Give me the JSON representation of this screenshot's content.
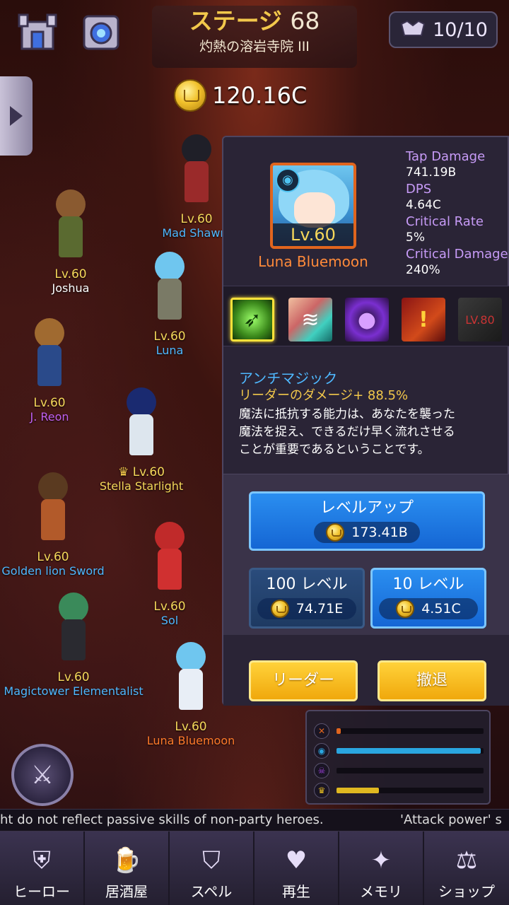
{
  "header": {
    "stage_label": "ステージ",
    "stage_number": "68",
    "stage_subtitle": "灼熱の溶岩寺院 III",
    "energy": "10/10",
    "gold": "120.16C"
  },
  "heroes_field": [
    {
      "level": "Lv.60",
      "name": "Mad Shawn."
    },
    {
      "level": "Lv.60",
      "name": "Joshua"
    },
    {
      "level": "Lv.60",
      "name": "Luna"
    },
    {
      "level": "Lv.60",
      "name": "J. Reon"
    },
    {
      "level": "Lv.60",
      "name": "Stella Starlight"
    },
    {
      "level": "Lv.60",
      "name": "Golden lion Sword"
    },
    {
      "level": "Lv.60",
      "name": "Sol"
    },
    {
      "level": "Lv.60",
      "name": "Magictower Elementalist"
    },
    {
      "level": "Lv.60",
      "name": "Luna Bluemoon"
    }
  ],
  "detail": {
    "portrait_level": "Lv.60",
    "hero_name": "Luna Bluemoon",
    "stats": [
      {
        "label": "Tap Damage",
        "value": "741.19B"
      },
      {
        "label": "DPS",
        "value": "4.64C"
      },
      {
        "label": "Critical Rate",
        "value": "5%"
      },
      {
        "label": "Critical Damage",
        "value": "240%"
      }
    ],
    "locked_skill_label": "LV.80",
    "skill": {
      "name": "アンチマジック",
      "effect": "リーダーのダメージ+ 88.5%",
      "description_lines": [
        "魔法に抵抗する能力は、あなたを襲った",
        "魔法を捉え、できるだけ早く流れさせる",
        "ことが重要であるということです。"
      ]
    },
    "level_up": {
      "label": "レベルアップ",
      "cost": "173.41B"
    },
    "level_100": {
      "label": "100 レベル",
      "cost": "74.71E"
    },
    "level_10": {
      "label": "10 レベル",
      "cost": "4.51C"
    },
    "leader_button": "リーダー",
    "retreat_button": "撤退"
  },
  "mini_panel": {
    "bars": [
      {
        "icon": "sword-icon",
        "fill": 0.03,
        "color": "#e0651e"
      },
      {
        "icon": "water-icon",
        "fill": 0.98,
        "color": "#2aa6e0"
      },
      {
        "icon": "skull-icon",
        "fill": 0.0,
        "color": "#a040e0"
      },
      {
        "icon": "crown-icon",
        "fill": 0.29,
        "color": "#e0b820"
      }
    ]
  },
  "ticker": {
    "text_1": "ht do not reflect passive skills of non-party heroes.",
    "text_2": "'Attack power' s"
  },
  "nav": [
    {
      "label": "ヒーロー",
      "icon": "helmet-icon"
    },
    {
      "label": "居酒屋",
      "icon": "beer-mug-icon"
    },
    {
      "label": "スペル",
      "icon": "shield-icon"
    },
    {
      "label": "再生",
      "icon": "heart-icon"
    },
    {
      "label": "メモリ",
      "icon": "star-icon"
    },
    {
      "label": "ショップ",
      "icon": "scales-icon"
    }
  ]
}
